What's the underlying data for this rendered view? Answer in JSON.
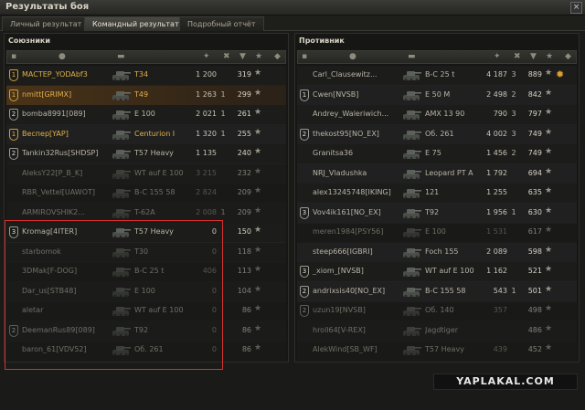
{
  "window": {
    "title": "Результаты боя",
    "close_label": "×"
  },
  "tabs": [
    {
      "label": "Личный результат",
      "active": false
    },
    {
      "label": "Командный результат",
      "active": true
    },
    {
      "label": "Подробный отчёт",
      "active": false
    }
  ],
  "allies": {
    "title": "Союзники",
    "rows": [
      {
        "player": "MACTEP_YODAbf3",
        "tank": "T34",
        "damage": "1 200",
        "kills": "",
        "xp": "319",
        "gold": true,
        "badge": "1"
      },
      {
        "player": "nmitt[GRIMX]",
        "tank": "T49",
        "damage": "1 263",
        "kills": "1",
        "xp": "299",
        "gold": true,
        "own": true,
        "badge": "1"
      },
      {
        "player": "bomba8991[089]",
        "tank": "E 100",
        "damage": "2 021",
        "kills": "1",
        "xp": "261",
        "badge": "2"
      },
      {
        "player": "Веспер[YAP]",
        "tank": "Centurion I",
        "damage": "1 320",
        "kills": "1",
        "xp": "255",
        "gold": true,
        "badge": "1"
      },
      {
        "player": "Tankin32Rus[SHDSP]",
        "tank": "T57 Heavy",
        "damage": "1 135",
        "kills": "",
        "xp": "240",
        "badge": "2"
      },
      {
        "player": "AleksY22[P_B_K]",
        "tank": "WT auf E 100",
        "damage": "3 215",
        "kills": "",
        "xp": "232",
        "dead": true
      },
      {
        "player": "RBR_Vettel[UAWOT]",
        "tank": "B-C 155 58",
        "damage": "2 824",
        "kills": "",
        "xp": "209",
        "dead": true
      },
      {
        "player": "ARMIROVSHIK2...",
        "tank": "T-62A",
        "damage": "2 008",
        "kills": "1",
        "xp": "209",
        "dead": true
      },
      {
        "player": "Kromag[4ITER]",
        "tank": "T57 Heavy",
        "damage": "0",
        "kills": "",
        "xp": "150",
        "badge": "3"
      },
      {
        "player": "starbomok",
        "tank": "T30",
        "damage": "0",
        "kills": "",
        "xp": "118",
        "dead": true
      },
      {
        "player": "3DMak[F-DOG]",
        "tank": "B-C 25 t",
        "damage": "406",
        "kills": "",
        "xp": "113",
        "dead": true
      },
      {
        "player": "Dar_us[STB48]",
        "tank": "E 100",
        "damage": "0",
        "kills": "",
        "xp": "104",
        "dead": true
      },
      {
        "player": "aletar",
        "tank": "WT auf E 100",
        "damage": "0",
        "kills": "",
        "xp": "86",
        "dead": true
      },
      {
        "player": "DeemanRus89[089]",
        "tank": "T92",
        "damage": "0",
        "kills": "",
        "xp": "86",
        "dead": true,
        "badge": "2"
      },
      {
        "player": "baron_61[VDV52]",
        "tank": "Об. 261",
        "damage": "0",
        "kills": "",
        "xp": "86",
        "dead": true
      }
    ]
  },
  "enemies": {
    "title": "Противник",
    "rows": [
      {
        "player": "Carl_Clausewitz...",
        "tank": "B-C 25 t",
        "damage": "4 187",
        "kills": "3",
        "xp": "889",
        "emblem": "✹"
      },
      {
        "player": "Cwen[NVSB]",
        "tank": "E 50 M",
        "damage": "2 498",
        "kills": "2",
        "xp": "842",
        "badge": "1"
      },
      {
        "player": "Andrey_Waleriwich...",
        "tank": "AMX 13 90",
        "damage": "790",
        "kills": "3",
        "xp": "797"
      },
      {
        "player": "thekost95[NO_EX]",
        "tank": "Об. 261",
        "damage": "4 002",
        "kills": "3",
        "xp": "749",
        "badge": "2"
      },
      {
        "player": "Granitsa36",
        "tank": "E 75",
        "damage": "1 456",
        "kills": "2",
        "xp": "749"
      },
      {
        "player": "NRJ_Vladushka",
        "tank": "Leopard PT A",
        "damage": "1 792",
        "kills": "",
        "xp": "694"
      },
      {
        "player": "alex13245748[IKING]",
        "tank": "121",
        "damage": "1 255",
        "kills": "",
        "xp": "635"
      },
      {
        "player": "Vov4ik161[NO_EX]",
        "tank": "T92",
        "damage": "1 956",
        "kills": "1",
        "xp": "630",
        "badge": "3"
      },
      {
        "player": "meren1984[PSY56]",
        "tank": "E 100",
        "damage": "1 531",
        "kills": "",
        "xp": "617",
        "dead": true
      },
      {
        "player": "steep666[IGBRI]",
        "tank": "Foch 155",
        "damage": "2 089",
        "kills": "",
        "xp": "598"
      },
      {
        "player": "_xiom_[NVSB]",
        "tank": "WT auf E 100",
        "damage": "1 162",
        "kills": "",
        "xp": "521",
        "badge": "3"
      },
      {
        "player": "andrixsis40[NO_EX]",
        "tank": "B-C 155 58",
        "damage": "543",
        "kills": "1",
        "xp": "501",
        "badge": "2"
      },
      {
        "player": "uzun19[NVSB]",
        "tank": "Об. 140",
        "damage": "357",
        "kills": "",
        "xp": "498",
        "dead": true,
        "badge": "2"
      },
      {
        "player": "hroll64[V-REX]",
        "tank": "Jagdtiger",
        "damage": "",
        "kills": "",
        "xp": "486",
        "dead": true
      },
      {
        "player": "AlekWind[SB_WF]",
        "tank": "T57 Heavy",
        "damage": "439",
        "kills": "",
        "xp": "452",
        "dead": true
      }
    ]
  },
  "icons": {
    "star": "★",
    "player_col": "👤",
    "sort": "▼"
  },
  "watermark": "YAPLAKAL.COM"
}
